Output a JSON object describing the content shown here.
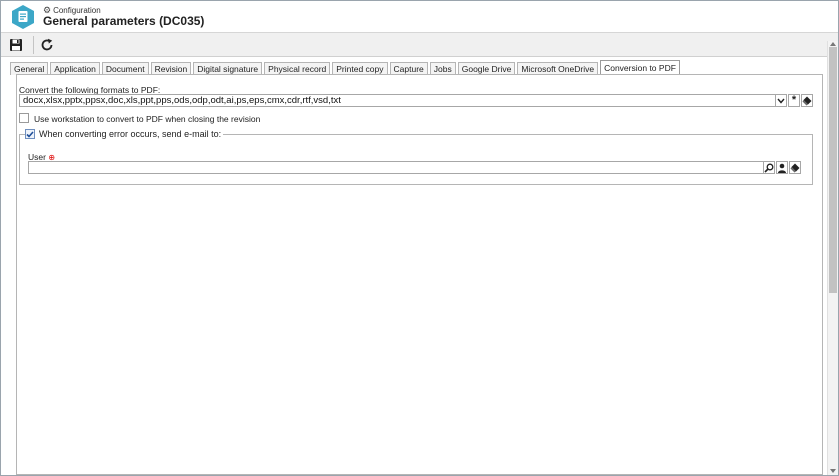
{
  "header": {
    "breadcrumb": "Configuration",
    "title": "General parameters (DC035)",
    "icon": "document-icon",
    "accent_color": "#3ca7c7"
  },
  "toolbar": {
    "save_icon": "save-icon",
    "refresh_icon": "refresh-icon"
  },
  "tabs": [
    {
      "label": "General"
    },
    {
      "label": "Application"
    },
    {
      "label": "Document"
    },
    {
      "label": "Revision"
    },
    {
      "label": "Digital signature"
    },
    {
      "label": "Physical record"
    },
    {
      "label": "Printed copy"
    },
    {
      "label": "Capture"
    },
    {
      "label": "Jobs"
    },
    {
      "label": "Google Drive"
    },
    {
      "label": "Microsoft OneDrive"
    },
    {
      "label": "Conversion to PDF",
      "active": true
    }
  ],
  "conversion": {
    "formats_label": "Convert the following formats to PDF:",
    "formats_value": "docx,xlsx,pptx,ppsx,doc,xls,ppt,pps,ods,odp,odt,ai,ps,eps,cmx,cdr,rtf,vsd,txt",
    "workstation_label": "Use workstation to convert to PDF when closing the revision",
    "workstation_checked": false,
    "error_email_label": "When converting error occurs, send e-mail to:",
    "error_email_checked": true,
    "user_label": "User",
    "user_value": ""
  }
}
